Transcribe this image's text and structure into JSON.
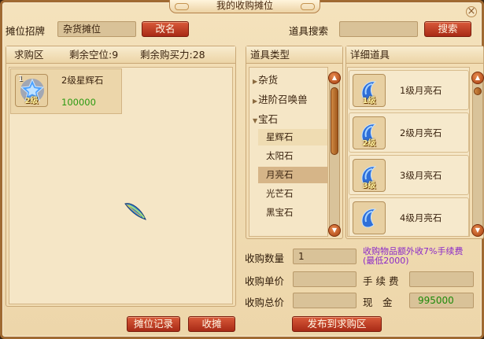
{
  "window": {
    "title": "我的收购摊位",
    "close_glyph": "×"
  },
  "header": {
    "sign_label": "摊位招牌",
    "sign_value": "杂货摊位",
    "rename_button": "改名",
    "search_label": "道具搜索",
    "search_value": "",
    "search_button": "搜索"
  },
  "buy_area": {
    "title": "求购区",
    "free_slots": "剩余空位:9",
    "remaining_power": "剩余购买力:28",
    "items": [
      {
        "count": "1",
        "name": "2级星辉石",
        "price": "100000",
        "level": "2级"
      }
    ]
  },
  "categories": {
    "title": "道具类型",
    "items": [
      {
        "label": "杂货",
        "arrow": "▶"
      },
      {
        "label": "进阶召唤兽",
        "arrow": "▶"
      },
      {
        "label": "宝石",
        "arrow": "▼"
      }
    ],
    "gems": [
      "星辉石",
      "太阳石",
      "月亮石",
      "光芒石",
      "黑宝石"
    ],
    "selected": "月亮石"
  },
  "details": {
    "title": "详细道具",
    "items": [
      {
        "name": "1级月亮石",
        "level": "1级"
      },
      {
        "name": "2级月亮石",
        "level": "2级"
      },
      {
        "name": "3级月亮石",
        "level": "3级"
      },
      {
        "name": "4级月亮石",
        "level": ""
      }
    ]
  },
  "form": {
    "quantity_label": "收购数量",
    "quantity_value": "1",
    "fee_note_line1": "收购物品额外收7%手续费",
    "fee_note_line2": "(最低2000)",
    "unit_price_label": "收购单价",
    "unit_price_value": "",
    "fee_label": "手 续 费",
    "fee_value": "",
    "total_label": "收购总价",
    "total_value": "",
    "cash_label": "现　金",
    "cash_value": "995000"
  },
  "footer": {
    "record_button": "摊位记录",
    "close_stall_button": "收摊",
    "publish_button": "发布到求购区"
  },
  "colors": {
    "price_green": "#2a9a10",
    "cash_green": "#1e8a0a",
    "note_purple": "#8a28c8",
    "button_red": "#b8341e"
  },
  "icons": {
    "star_gem": "blue-star-gem-icon",
    "moon_gem": "blue-moonstone-icon",
    "cursor": "feather-cursor-icon"
  }
}
